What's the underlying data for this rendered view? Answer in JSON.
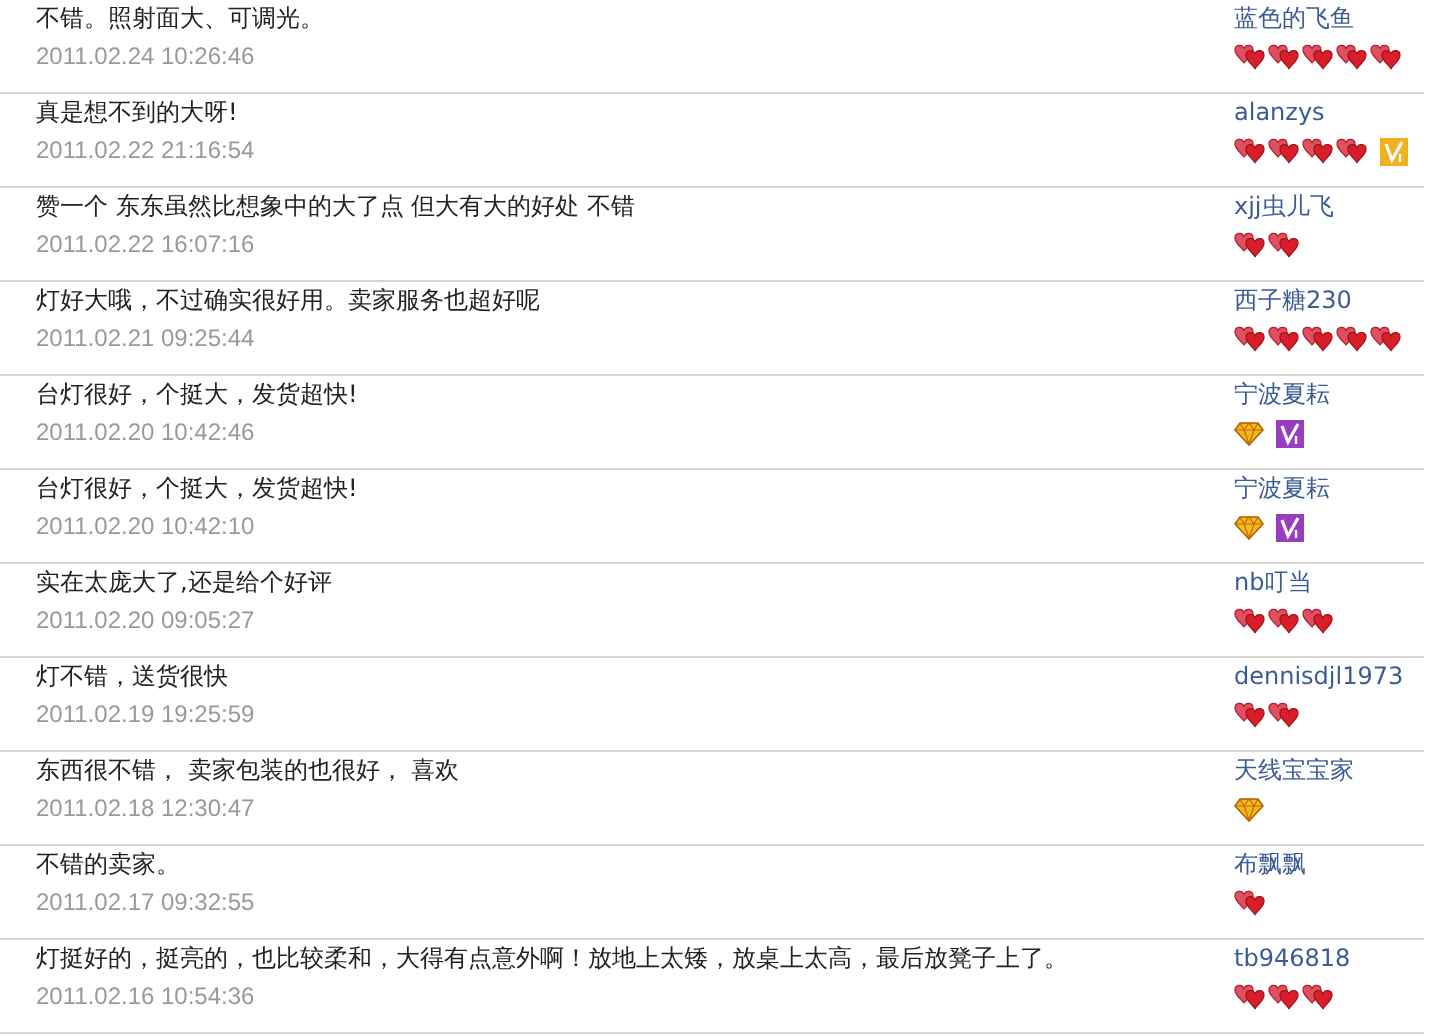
{
  "reviews": [
    {
      "comment": "不错。照射面大、可调光。",
      "date": "2011.02.24 10:26:46",
      "user": "蓝色的飞鱼",
      "credit": [
        {
          "kind": "heart"
        },
        {
          "kind": "heart"
        },
        {
          "kind": "heart"
        },
        {
          "kind": "heart"
        },
        {
          "kind": "heart"
        }
      ]
    },
    {
      "comment": "真是想不到的大呀!",
      "date": "2011.02.22 21:16:54",
      "user": "alanzys",
      "credit": [
        {
          "kind": "heart"
        },
        {
          "kind": "heart"
        },
        {
          "kind": "heart"
        },
        {
          "kind": "heart"
        },
        {
          "kind": "vip",
          "color": "#f0b020"
        }
      ]
    },
    {
      "comment": "赞一个 东东虽然比想象中的大了点 但大有大的好处 不错",
      "date": "2011.02.22 16:07:16",
      "user": "xjj虫儿飞",
      "credit": [
        {
          "kind": "heart"
        },
        {
          "kind": "heart"
        }
      ]
    },
    {
      "comment": "灯好大哦，不过确实很好用。卖家服务也超好呢",
      "date": "2011.02.21 09:25:44",
      "user": "西子糖230",
      "credit": [
        {
          "kind": "heart"
        },
        {
          "kind": "heart"
        },
        {
          "kind": "heart"
        },
        {
          "kind": "heart"
        },
        {
          "kind": "heart"
        }
      ]
    },
    {
      "comment": "台灯很好，个挺大，发货超快!",
      "date": "2011.02.20 10:42:46",
      "user": "宁波夏耘",
      "credit": [
        {
          "kind": "diamond"
        },
        {
          "kind": "vip",
          "color": "#9a3cc0"
        }
      ]
    },
    {
      "comment": "台灯很好，个挺大，发货超快!",
      "date": "2011.02.20 10:42:10",
      "user": "宁波夏耘",
      "credit": [
        {
          "kind": "diamond"
        },
        {
          "kind": "vip",
          "color": "#9a3cc0"
        }
      ]
    },
    {
      "comment": "实在太庞大了,还是给个好评",
      "date": "2011.02.20 09:05:27",
      "user": "nb叮当",
      "credit": [
        {
          "kind": "heart"
        },
        {
          "kind": "heart"
        },
        {
          "kind": "heart"
        }
      ]
    },
    {
      "comment": "灯不错，送货很快",
      "date": "2011.02.19 19:25:59",
      "user": "dennisdjl1973",
      "credit": [
        {
          "kind": "heart"
        },
        {
          "kind": "heart"
        }
      ]
    },
    {
      "comment": "东西很不错， 卖家包装的也很好， 喜欢",
      "date": "2011.02.18 12:30:47",
      "user": "天线宝宝家",
      "credit": [
        {
          "kind": "diamond"
        }
      ]
    },
    {
      "comment": "不错的卖家。",
      "date": "2011.02.17 09:32:55",
      "user": "布飘飘",
      "credit": [
        {
          "kind": "heart"
        }
      ]
    },
    {
      "comment": "灯挺好的，挺亮的，也比较柔和，大得有点意外啊！放地上太矮，放桌上太高，最后放凳子上了。",
      "date": "2011.02.16 10:54:36",
      "user": "tb946818",
      "credit": [
        {
          "kind": "heart"
        },
        {
          "kind": "heart"
        },
        {
          "kind": "heart"
        }
      ]
    }
  ]
}
